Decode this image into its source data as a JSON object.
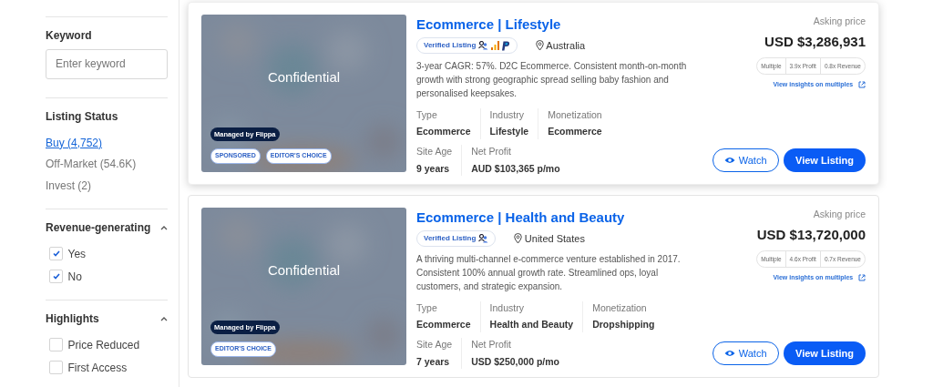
{
  "sidebar": {
    "keyword": {
      "label": "Keyword",
      "placeholder": "Enter keyword"
    },
    "listing_status": {
      "label": "Listing Status",
      "items": [
        {
          "label": "Buy (4,752)",
          "selected": true
        },
        {
          "label": "Off-Market (54.6K)",
          "selected": false
        },
        {
          "label": "Invest (2)",
          "selected": false
        }
      ]
    },
    "sections": [
      {
        "label": "Revenue-generating",
        "expanded": true,
        "options": [
          {
            "label": "Yes",
            "checked": true
          },
          {
            "label": "No",
            "checked": true
          }
        ]
      },
      {
        "label": "Highlights",
        "expanded": true,
        "options": [
          {
            "label": "Price Reduced",
            "checked": false
          },
          {
            "label": "First Access",
            "checked": false
          }
        ]
      }
    ]
  },
  "listings": [
    {
      "title": "Ecommerce | Lifestyle",
      "highlighted": true,
      "image": {
        "overlay_text": "Confidential",
        "managed_badge": "Managed by Flippa",
        "tags": [
          "SPONSORED",
          "EDITOR'S CHOICE"
        ]
      },
      "verified_label": "Verified Listing",
      "verified_icons": [
        {
          "kind": "people"
        },
        {
          "kind": "analytics"
        },
        {
          "kind": "payments"
        }
      ],
      "location": "Australia",
      "description": "3-year CAGR: 57%. D2C Ecommerce. Consistent month-on-month growth with strong geographic spread selling baby fashion and personalised keepsakes.",
      "stats": [
        [
          {
            "label": "Type",
            "value": "Ecommerce"
          },
          {
            "label": "Industry",
            "value": "Lifestyle"
          },
          {
            "label": "Monetization",
            "value": "Ecommerce"
          }
        ],
        [
          {
            "label": "Site Age",
            "value": "9 years"
          },
          {
            "label": "Net Profit",
            "value": "AUD $103,365 p/mo"
          }
        ]
      ],
      "asking_label": "Asking price",
      "price": "USD $3,286,931",
      "multiples": [
        "Multiple",
        "3.9x Profit",
        "0.8x Revenue"
      ],
      "insights_link": "View insights on multiples",
      "watch_label": "Watch",
      "view_label": "View Listing"
    },
    {
      "title": "Ecommerce | Health and Beauty",
      "highlighted": false,
      "image": {
        "overlay_text": "Confidential",
        "managed_badge": "Managed by Flippa",
        "tags": [
          "EDITOR'S CHOICE"
        ]
      },
      "verified_label": "Verified Listing",
      "verified_icons": [
        {
          "kind": "people"
        }
      ],
      "location": "United States",
      "description": "A thriving multi-channel e-commerce venture established in 2017. Consistent 100% annual growth rate. Streamlined ops, loyal customers, and strategic expansion.",
      "stats": [
        [
          {
            "label": "Type",
            "value": "Ecommerce"
          },
          {
            "label": "Industry",
            "value": "Health and Beauty"
          },
          {
            "label": "Monetization",
            "value": "Dropshipping"
          }
        ],
        [
          {
            "label": "Site Age",
            "value": "7 years"
          },
          {
            "label": "Net Profit",
            "value": "USD $250,000 p/mo"
          }
        ]
      ],
      "asking_label": "Asking price",
      "price": "USD $13,720,000",
      "multiples": [
        "Multiple",
        "4.6x Profit",
        "0.7x Revenue"
      ],
      "insights_link": "View insights on multiples",
      "watch_label": "Watch",
      "view_label": "View Listing"
    }
  ]
}
